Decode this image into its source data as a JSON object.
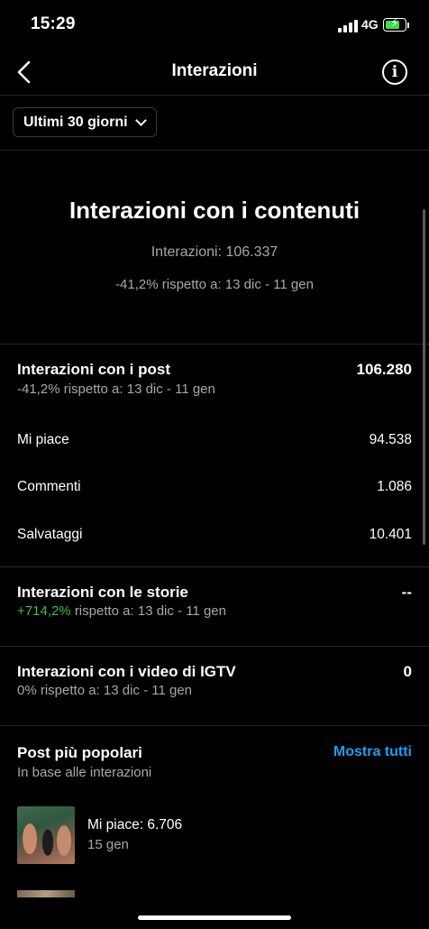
{
  "status_bar": {
    "time": "15:29",
    "network": "4G",
    "battery_color": "#3fdc4b"
  },
  "header": {
    "title": "Interazioni",
    "back_icon": "chevron-left-icon",
    "info_icon": "info-icon"
  },
  "filter": {
    "label": "Ultimi 30 giorni"
  },
  "summary": {
    "title": "Interazioni con i contenuti",
    "total": "Interazioni: 106.337",
    "comparison": "-41,2% rispetto a: 13 dic - 11 gen"
  },
  "posts": {
    "title": "Interazioni con i post",
    "value": "106.280",
    "comparison": "-41,2% rispetto a: 13 dic - 11 gen",
    "metrics": [
      {
        "label": "Mi piace",
        "value": "94.538"
      },
      {
        "label": "Commenti",
        "value": "1.086"
      },
      {
        "label": "Salvataggi",
        "value": "10.401"
      }
    ]
  },
  "stories": {
    "title": "Interazioni con le storie",
    "value": "--",
    "change": "+714,2%",
    "comparison": "rispetto a: 13 dic - 11 gen"
  },
  "igtv": {
    "title": "Interazioni con i video di IGTV",
    "value": "0",
    "comparison": "0% rispetto a: 13 dic - 11 gen"
  },
  "popular": {
    "title": "Post più popolari",
    "subtitle": "In base alle interazioni",
    "link": "Mostra tutti",
    "link_color": "#1f9cf0",
    "items": [
      {
        "likes": "Mi piace: 6.706",
        "date": "15 gen"
      }
    ]
  }
}
